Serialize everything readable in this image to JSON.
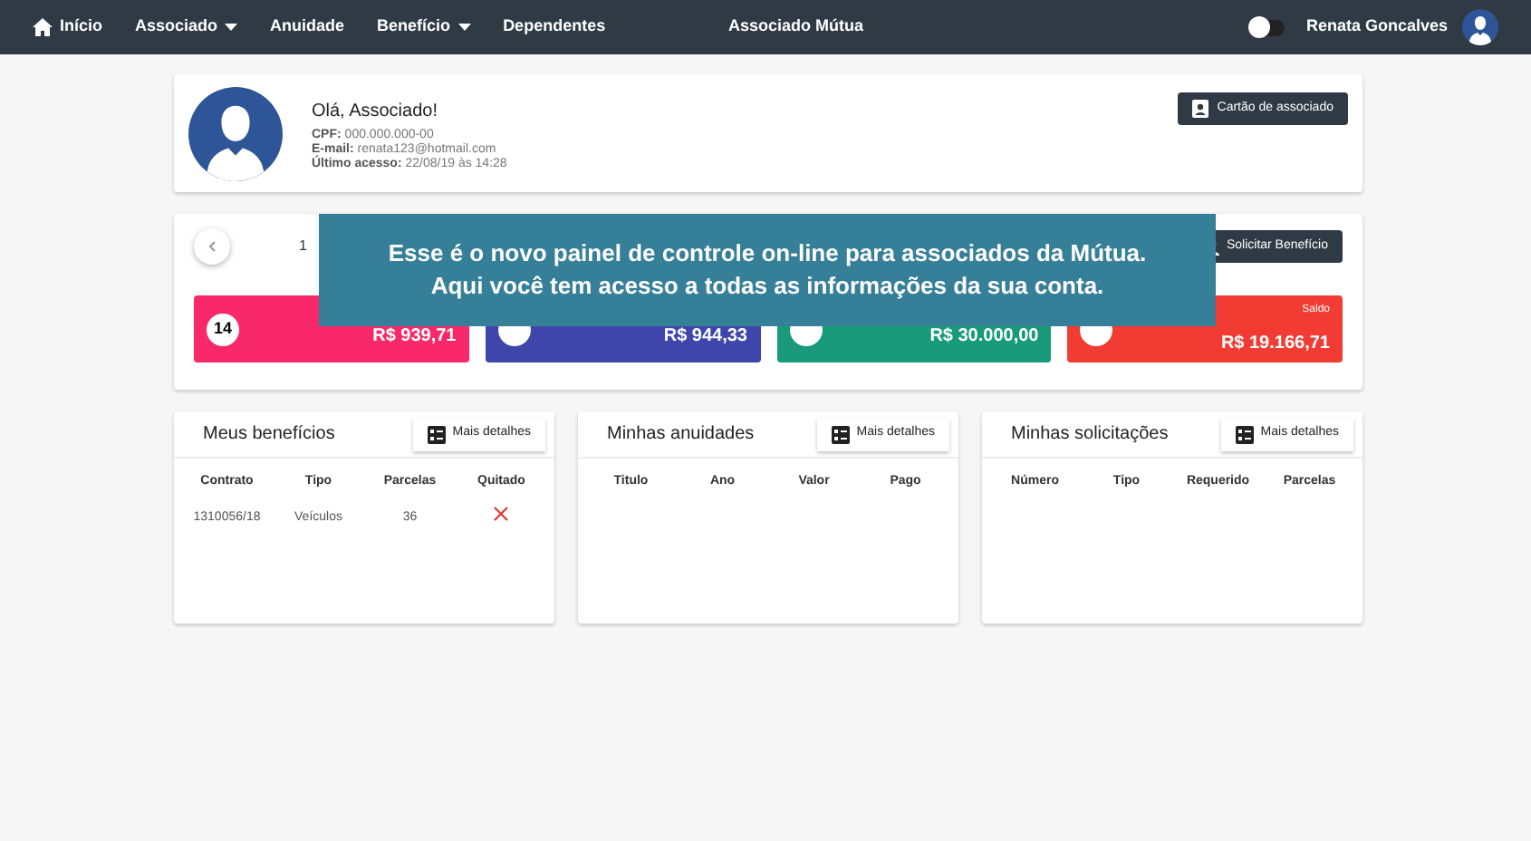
{
  "navbar": {
    "items": [
      {
        "label": "Início",
        "kind": "home"
      },
      {
        "label": "Associado",
        "kind": "menu"
      },
      {
        "label": "Anuidade",
        "kind": "link"
      },
      {
        "label": "Benefício",
        "kind": "menu"
      },
      {
        "label": "Dependentes",
        "kind": "link"
      }
    ],
    "title": "Associado Mútua",
    "toggle": {
      "on": false
    },
    "user": "Renata Goncalves"
  },
  "profile": {
    "greeting": "Olá, Associado!",
    "fields": [
      {
        "label": "CPF:",
        "value": "000.000.000-00"
      },
      {
        "label": "E-mail:",
        "value": "renata123@hotmail.com"
      },
      {
        "label": "Último acesso:",
        "value": "22/08/19 às 14:28"
      }
    ],
    "button": "Cartão de associado"
  },
  "summary": {
    "page": "1",
    "button": "Solicitar Benefício",
    "cards": [
      {
        "badge": "14",
        "amount": "R$ 939,71",
        "color": "#f8286a"
      },
      {
        "amount": "R$ 944,33",
        "color": "#3f46ab"
      },
      {
        "amount": "R$ 30.000,00",
        "color": "#189a7b"
      },
      {
        "label": "Saldo",
        "amount": "R$ 19.166,71",
        "color": "#f23c33"
      }
    ]
  },
  "overlay": {
    "lines": [
      "Esse é o novo painel de controle on-line para associados da Mútua.",
      "Aqui você tem acesso a todas as informações da sua conta."
    ]
  },
  "panels": [
    {
      "title": "Meus benefícios",
      "button": "Mais detalhes",
      "columns": [
        "Contrato",
        "Tipo",
        "Parcelas",
        "Quitado"
      ],
      "rows": [
        {
          "cells": [
            "1310056/18",
            "Veículos",
            "36"
          ],
          "paid": false
        }
      ]
    },
    {
      "title": "Minhas anuidades",
      "button": "Mais detalhes",
      "columns": [
        "Titulo",
        "Ano",
        "Valor",
        "Pago"
      ]
    },
    {
      "title": "Minhas solicitações",
      "button": "Mais detalhes",
      "columns": [
        "Número",
        "Tipo",
        "Requerido",
        "Parcelas"
      ]
    }
  ]
}
